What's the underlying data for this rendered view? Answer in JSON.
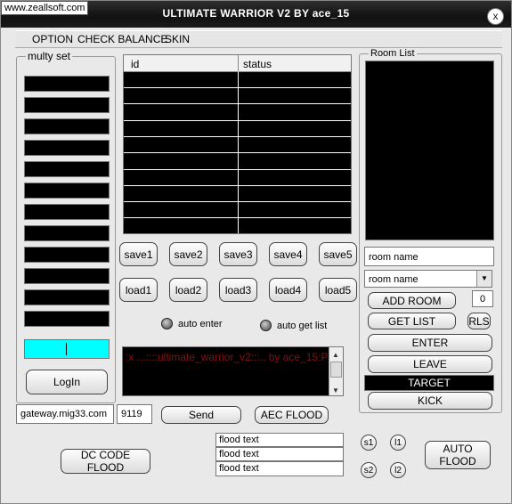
{
  "watermark": "www.zeallsoft.com",
  "title": "ULTIMATE WARRIOR V2 BY ace_15",
  "close_icon": "x",
  "menu": [
    "OPTION",
    "CHECK BALANCE",
    "SKIN"
  ],
  "multy_set": {
    "title": "multy set",
    "slots": 12
  },
  "table": {
    "columns": [
      "id",
      "status"
    ],
    "rows": 10
  },
  "save_buttons": [
    "save1",
    "save2",
    "save3",
    "save4",
    "save5"
  ],
  "load_buttons": [
    "load1",
    "load2",
    "load3",
    "load4",
    "load5"
  ],
  "radios": {
    "auto_enter": "auto enter",
    "auto_get_list": "auto get list"
  },
  "login_button": "LogIn",
  "log_text": ":x ...::::ultimate_warrior_v2:::.. by ace_15:P",
  "server": {
    "host": "gateway.mig33.com",
    "port": "9119"
  },
  "send_button": "Send",
  "aec_flood_button": "AEC FLOOD",
  "dc_code_flood_button": "DC CODE FLOOD",
  "flood_texts": [
    "flood text",
    "flood text",
    "flood text"
  ],
  "flood_buttons": {
    "s1": "s1",
    "l1": "l1",
    "s2": "s2",
    "l2": "l2",
    "auto": "AUTO FLOOD"
  },
  "room": {
    "title": "Room List",
    "name_field": "room name",
    "name_select": "room name",
    "count": "0",
    "add_room": "ADD ROOM",
    "get_list": "GET LIST",
    "rls": "RLS",
    "enter": "ENTER",
    "leave": "LEAVE",
    "target": "TARGET",
    "kick": "KICK"
  }
}
